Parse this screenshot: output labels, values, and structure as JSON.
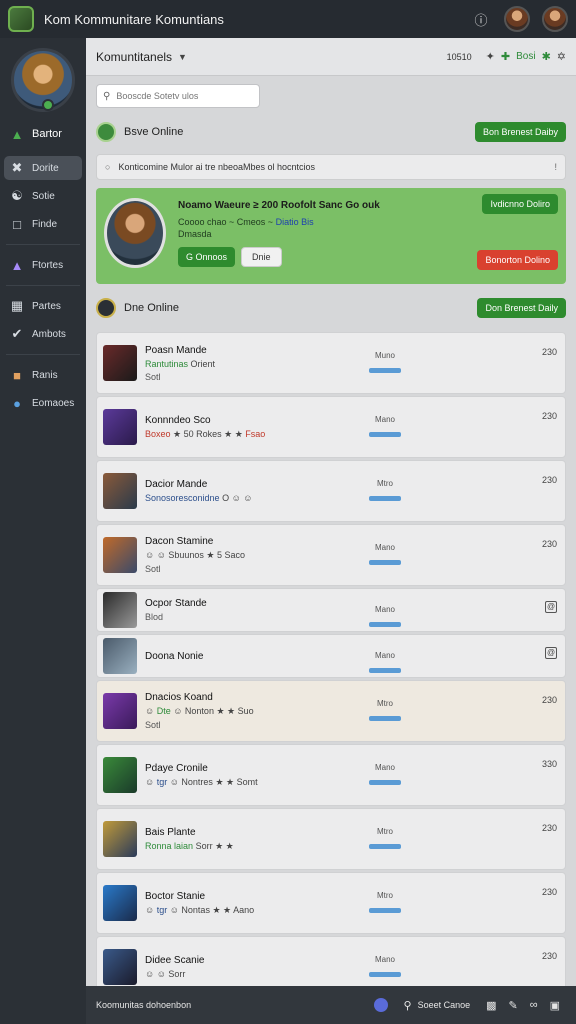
{
  "window": {
    "title": "Kom Kommunitare Komuntians"
  },
  "sidebar": {
    "items": [
      {
        "label": "Bartor",
        "icon": "controller-icon"
      },
      {
        "label": "Dorite",
        "icon": "cross-icon"
      },
      {
        "label": "Sotie",
        "icon": "headset-icon"
      },
      {
        "label": "Finde",
        "icon": "window-icon"
      },
      {
        "label": "Ftortes",
        "icon": "chart-icon"
      },
      {
        "label": "Partes",
        "icon": "map-icon"
      },
      {
        "label": "Ambots",
        "icon": "check-icon"
      },
      {
        "label": "Ranis",
        "icon": "gift-icon"
      },
      {
        "label": "Eomaoes",
        "icon": "chat-icon"
      }
    ]
  },
  "header": {
    "title": "Komuntitanels",
    "meta": "10510",
    "label": "Bosi"
  },
  "search": {
    "placeholder": "Booscde Sotetv ulos"
  },
  "section_online": {
    "title": "Bsve Online",
    "button": "Bon Brenest Daiby"
  },
  "info_bar": {
    "text": "Konticomine Mulor ai tre nbeoaMbes ol hocntcios",
    "end": "!"
  },
  "featured": {
    "title": "Noamo Waeure ≥ 200 Roofolt Sanc Go ouk",
    "sub_prefix": "Coooo chao ~ Cmeos ~",
    "sub_tag": "Diatio Bis",
    "sub2": "Dmasda",
    "btn_primary": "G Onnoos",
    "btn_secondary": "Dnie",
    "btn_top": "Ivdicnno Doliro",
    "btn_bottom": "Bonorton Dolino"
  },
  "section_done": {
    "title": "Dne Online",
    "button": "Don Brenest Daily"
  },
  "rows": [
    {
      "name": "Poasn Mande",
      "sub_green": "Rantutinas",
      "sub": "Orient",
      "sub3": "Sotl",
      "status": "Muno",
      "num": "230"
    },
    {
      "name": "Konnndeo Sco",
      "sub_red": "Boxeo",
      "sub": "50 Rokes",
      "sub_end": "Fsao",
      "status": "Mano",
      "num": "230"
    },
    {
      "name": "Dacior Mande",
      "sub_blue": "Sonosoresconidne",
      "sub": "O",
      "status": "Mtro",
      "num": "230"
    },
    {
      "name": "Dacon Stamine",
      "sub": "Sbuunos",
      "sub_end": "5 Saco",
      "sub3": "Sotl",
      "status": "Mano",
      "num": "230"
    },
    {
      "name": "Ocpor Stande",
      "sub3": "Blod",
      "status": "Mano",
      "box": "@"
    },
    {
      "name": "Doona Nonie",
      "status": "Mano",
      "box": "@"
    },
    {
      "name": "Dnacios Koand",
      "sub_green": "Dte",
      "sub": "Nonton",
      "sub_end": "Suo",
      "sub3": "Sotl",
      "status": "Mtro",
      "num": "230"
    },
    {
      "name": "Pdaye Cronile",
      "sub_blue": "tgr",
      "sub": "Nontres",
      "sub_end": "Somt",
      "status": "Mano",
      "num": "330"
    },
    {
      "name": "Bais Plante",
      "sub_green": "Ronna laian",
      "sub": "Sorr",
      "status": "Mtro",
      "num": "230"
    },
    {
      "name": "Boctor Stanie",
      "sub_blue": "tgr",
      "sub": "Nontas",
      "sub_end": "Aano",
      "status": "Mtro",
      "num": "230"
    },
    {
      "name": "Didee Scanie",
      "sub": "Sorr",
      "status": "Mano",
      "num": "230"
    }
  ],
  "bottombar": {
    "text": "Koomunitas dohoenbon",
    "label": "Soeet Canoe"
  },
  "colors": {
    "accent_green": "#2e8b2e",
    "featured_bg": "#7bbf66",
    "danger": "#d9412f",
    "status_blue": "#5a9bd5"
  }
}
